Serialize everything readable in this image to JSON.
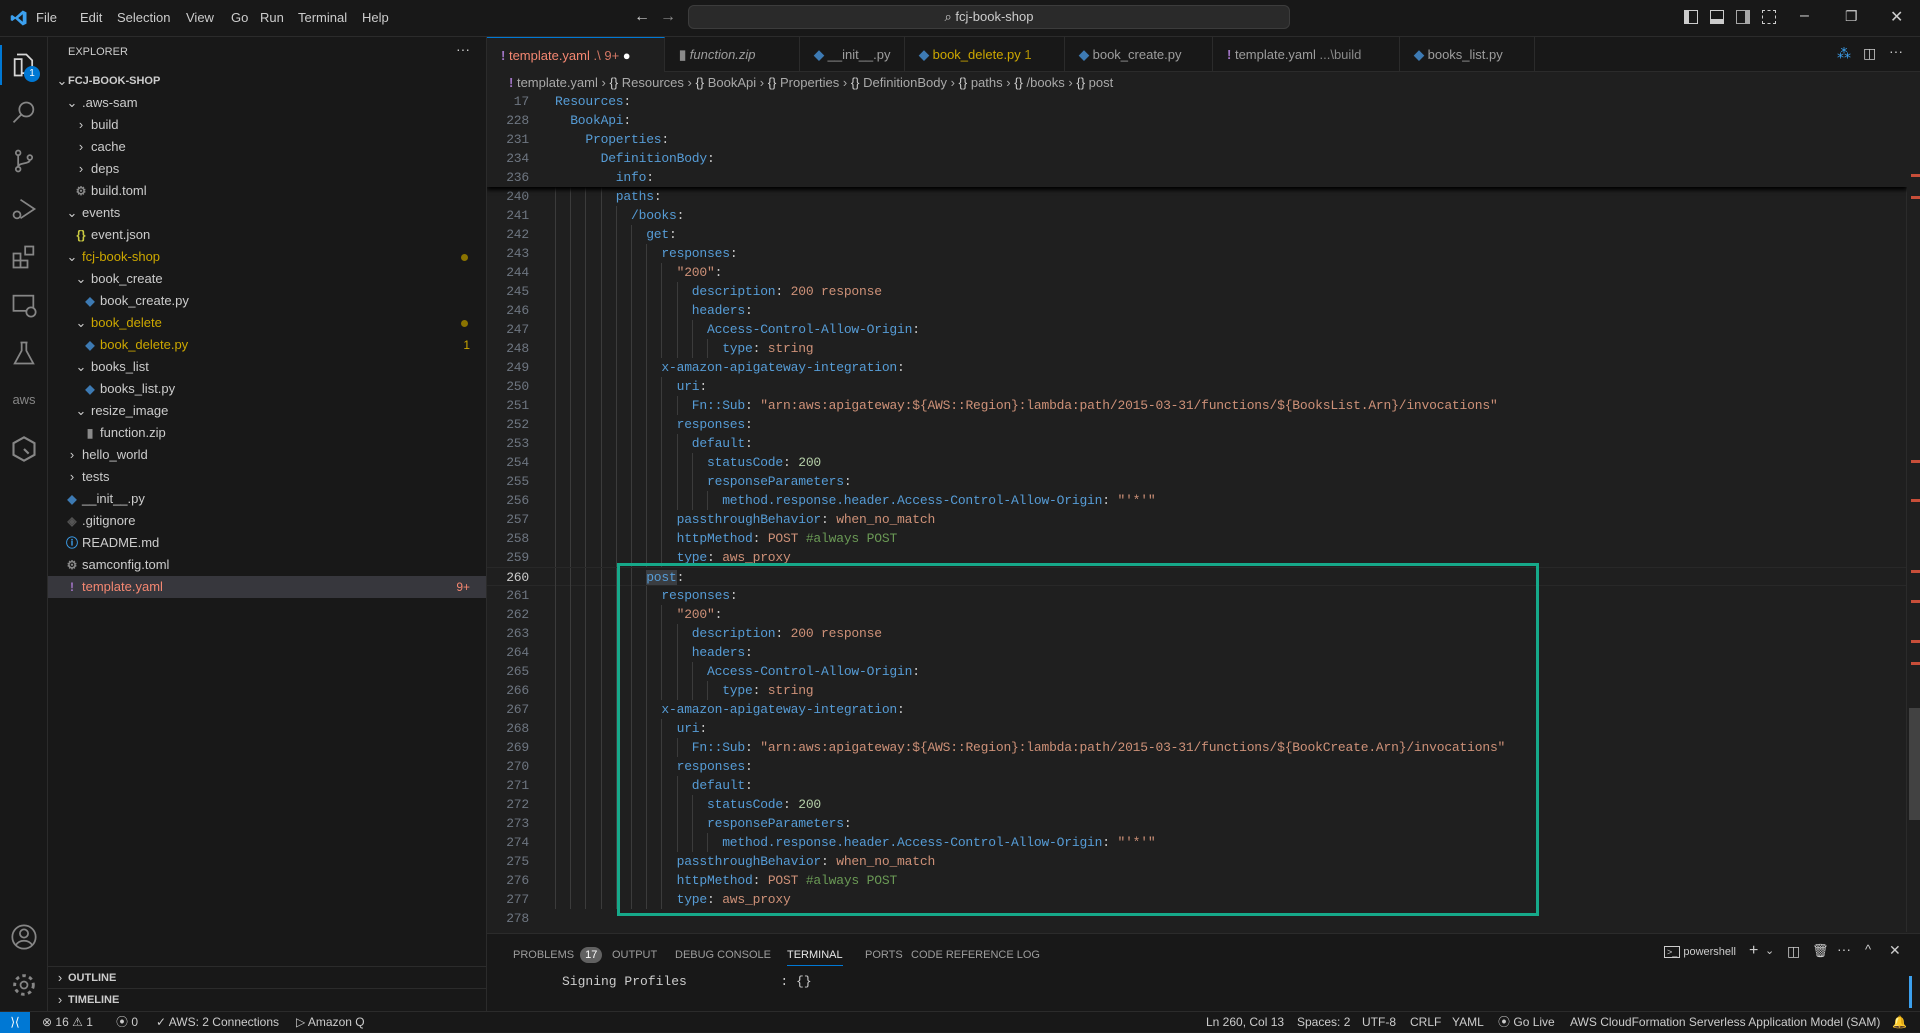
{
  "titlebar": {
    "menus": [
      "File",
      "Edit",
      "Selection",
      "View",
      "Go",
      "Run",
      "Terminal",
      "Help"
    ],
    "search": "fcj-book-shop"
  },
  "colors": {
    "accent": "#0078d4",
    "highlight_box": "#16a98a",
    "git_modified": "#cca700",
    "error": "#f48771"
  },
  "sidebar": {
    "title": "EXPLORER",
    "root": "FCJ-BOOK-SHOP",
    "outline": "OUTLINE",
    "timeline": "TIMELINE",
    "explorer_badge": "1",
    "items": [
      {
        "label": ".aws-sam",
        "level": 0,
        "kind": "folder-open"
      },
      {
        "label": "build",
        "level": 1,
        "kind": "folder-closed"
      },
      {
        "label": "cache",
        "level": 1,
        "kind": "folder-closed"
      },
      {
        "label": "deps",
        "level": 1,
        "kind": "folder-closed"
      },
      {
        "label": "build.toml",
        "level": 1,
        "kind": "file",
        "icon": "gear"
      },
      {
        "label": "events",
        "level": 0,
        "kind": "folder-open"
      },
      {
        "label": "event.json",
        "level": 1,
        "kind": "file",
        "icon": "json"
      },
      {
        "label": "fcj-book-shop",
        "level": 0,
        "kind": "folder-open",
        "status": "modified",
        "dot": true
      },
      {
        "label": "book_create",
        "level": 1,
        "kind": "folder-open"
      },
      {
        "label": "book_create.py",
        "level": 2,
        "kind": "file",
        "icon": "python"
      },
      {
        "label": "book_delete",
        "level": 1,
        "kind": "folder-open",
        "status": "modified",
        "dot": true
      },
      {
        "label": "book_delete.py",
        "level": 2,
        "kind": "file",
        "icon": "python",
        "status": "modified",
        "badge": "1"
      },
      {
        "label": "books_list",
        "level": 1,
        "kind": "folder-open"
      },
      {
        "label": "books_list.py",
        "level": 2,
        "kind": "file",
        "icon": "python"
      },
      {
        "label": "resize_image",
        "level": 1,
        "kind": "folder-open"
      },
      {
        "label": "function.zip",
        "level": 2,
        "kind": "file",
        "icon": "zip"
      },
      {
        "label": "hello_world",
        "level": 0,
        "kind": "folder-closed"
      },
      {
        "label": "tests",
        "level": 0,
        "kind": "folder-closed"
      },
      {
        "label": "__init__.py",
        "level": 0,
        "kind": "file",
        "icon": "python"
      },
      {
        "label": ".gitignore",
        "level": 0,
        "kind": "file",
        "icon": "git"
      },
      {
        "label": "README.md",
        "level": 0,
        "kind": "file",
        "icon": "info"
      },
      {
        "label": "samconfig.toml",
        "level": 0,
        "kind": "file",
        "icon": "gear"
      },
      {
        "label": "template.yaml",
        "level": 0,
        "kind": "file",
        "icon": "yaml",
        "status": "error",
        "badge": "9+",
        "selected": true
      }
    ]
  },
  "tabs": [
    {
      "label": "template.yaml",
      "desc": ".\\ 9+",
      "icon": "yaml",
      "active": true,
      "dirty": true
    },
    {
      "label": "function.zip",
      "icon": "zip",
      "italic": true
    },
    {
      "label": "__init__.py",
      "icon": "python"
    },
    {
      "label": "book_delete.py",
      "desc": "1",
      "icon": "python",
      "status": "modified"
    },
    {
      "label": "book_create.py",
      "icon": "python"
    },
    {
      "label": "template.yaml",
      "desc": "...\\build",
      "icon": "yaml"
    },
    {
      "label": "books_list.py",
      "icon": "python"
    }
  ],
  "breadcrumb": [
    "template.yaml",
    "Resources",
    "BookApi",
    "Properties",
    "DefinitionBody",
    "paths",
    "/books",
    "post"
  ],
  "editor": {
    "current_line": 260,
    "sticky": [
      {
        "n": 17,
        "i": 0,
        "t": [
          [
            "k",
            "Resources"
          ],
          [
            "p",
            ":"
          ]
        ]
      },
      {
        "n": 228,
        "i": 2,
        "t": [
          [
            "k",
            "BookApi"
          ],
          [
            "p",
            ":"
          ]
        ]
      },
      {
        "n": 231,
        "i": 4,
        "t": [
          [
            "k",
            "Properties"
          ],
          [
            "p",
            ":"
          ]
        ]
      },
      {
        "n": 234,
        "i": 6,
        "t": [
          [
            "k",
            "DefinitionBody"
          ],
          [
            "p",
            ":"
          ]
        ]
      },
      {
        "n": 236,
        "i": 8,
        "t": [
          [
            "k",
            "info"
          ],
          [
            "p",
            ":"
          ]
        ]
      }
    ],
    "lines": [
      {
        "n": 240,
        "i": 8,
        "t": [
          [
            "k",
            "paths"
          ],
          [
            "p",
            ":"
          ]
        ]
      },
      {
        "n": 241,
        "i": 10,
        "t": [
          [
            "k",
            "/books"
          ],
          [
            "p",
            ":"
          ]
        ]
      },
      {
        "n": 242,
        "i": 12,
        "t": [
          [
            "k",
            "get"
          ],
          [
            "p",
            ":"
          ]
        ]
      },
      {
        "n": 243,
        "i": 14,
        "t": [
          [
            "k",
            "responses"
          ],
          [
            "p",
            ":"
          ]
        ]
      },
      {
        "n": 244,
        "i": 16,
        "t": [
          [
            "s",
            "\"200\""
          ],
          [
            "p",
            ":"
          ]
        ]
      },
      {
        "n": 245,
        "i": 18,
        "t": [
          [
            "k",
            "description"
          ],
          [
            "p",
            ": "
          ],
          [
            "s",
            "200 response"
          ]
        ]
      },
      {
        "n": 246,
        "i": 18,
        "t": [
          [
            "k",
            "headers"
          ],
          [
            "p",
            ":"
          ]
        ]
      },
      {
        "n": 247,
        "i": 20,
        "t": [
          [
            "k",
            "Access-Control-Allow-Origin"
          ],
          [
            "p",
            ":"
          ]
        ]
      },
      {
        "n": 248,
        "i": 22,
        "t": [
          [
            "k",
            "type"
          ],
          [
            "p",
            ": "
          ],
          [
            "s",
            "string"
          ]
        ]
      },
      {
        "n": 249,
        "i": 14,
        "t": [
          [
            "k",
            "x-amazon-apigateway-integration"
          ],
          [
            "p",
            ":"
          ]
        ]
      },
      {
        "n": 250,
        "i": 16,
        "t": [
          [
            "k",
            "uri"
          ],
          [
            "p",
            ":"
          ]
        ]
      },
      {
        "n": 251,
        "i": 18,
        "t": [
          [
            "k",
            "Fn::Sub"
          ],
          [
            "p",
            ": "
          ],
          [
            "s",
            "\"arn:aws:apigateway:${AWS::Region}:lambda:path/2015-03-31/functions/${BooksList.Arn}/invocations\""
          ]
        ]
      },
      {
        "n": 252,
        "i": 16,
        "t": [
          [
            "k",
            "responses"
          ],
          [
            "p",
            ":"
          ]
        ]
      },
      {
        "n": 253,
        "i": 18,
        "t": [
          [
            "k",
            "default"
          ],
          [
            "p",
            ":"
          ]
        ]
      },
      {
        "n": 254,
        "i": 20,
        "t": [
          [
            "k",
            "statusCode"
          ],
          [
            "p",
            ": "
          ],
          [
            "n",
            "200"
          ]
        ]
      },
      {
        "n": 255,
        "i": 20,
        "t": [
          [
            "k",
            "responseParameters"
          ],
          [
            "p",
            ":"
          ]
        ]
      },
      {
        "n": 256,
        "i": 22,
        "t": [
          [
            "k",
            "method.response.header.Access-Control-Allow-Origin"
          ],
          [
            "p",
            ": "
          ],
          [
            "s",
            "\"'*'\""
          ]
        ]
      },
      {
        "n": 257,
        "i": 16,
        "t": [
          [
            "k",
            "passthroughBehavior"
          ],
          [
            "p",
            ": "
          ],
          [
            "s",
            "when_no_match"
          ]
        ]
      },
      {
        "n": 258,
        "i": 16,
        "t": [
          [
            "k",
            "httpMethod"
          ],
          [
            "p",
            ": "
          ],
          [
            "s",
            "POST "
          ],
          [
            "c",
            "#always POST"
          ]
        ]
      },
      {
        "n": 259,
        "i": 16,
        "t": [
          [
            "k",
            "type"
          ],
          [
            "p",
            ": "
          ],
          [
            "s",
            "aws_proxy"
          ]
        ]
      },
      {
        "n": 260,
        "i": 12,
        "t": [
          [
            "k",
            "post"
          ],
          [
            "p",
            ":"
          ]
        ],
        "selected_word": "post"
      },
      {
        "n": 261,
        "i": 14,
        "t": [
          [
            "k",
            "responses"
          ],
          [
            "p",
            ":"
          ]
        ]
      },
      {
        "n": 262,
        "i": 16,
        "t": [
          [
            "s",
            "\"200\""
          ],
          [
            "p",
            ":"
          ]
        ]
      },
      {
        "n": 263,
        "i": 18,
        "t": [
          [
            "k",
            "description"
          ],
          [
            "p",
            ": "
          ],
          [
            "s",
            "200 response"
          ]
        ]
      },
      {
        "n": 264,
        "i": 18,
        "t": [
          [
            "k",
            "headers"
          ],
          [
            "p",
            ":"
          ]
        ]
      },
      {
        "n": 265,
        "i": 20,
        "t": [
          [
            "k",
            "Access-Control-Allow-Origin"
          ],
          [
            "p",
            ":"
          ]
        ]
      },
      {
        "n": 266,
        "i": 22,
        "t": [
          [
            "k",
            "type"
          ],
          [
            "p",
            ": "
          ],
          [
            "s",
            "string"
          ]
        ]
      },
      {
        "n": 267,
        "i": 14,
        "t": [
          [
            "k",
            "x-amazon-apigateway-integration"
          ],
          [
            "p",
            ":"
          ]
        ]
      },
      {
        "n": 268,
        "i": 16,
        "t": [
          [
            "k",
            "uri"
          ],
          [
            "p",
            ":"
          ]
        ]
      },
      {
        "n": 269,
        "i": 18,
        "t": [
          [
            "k",
            "Fn::Sub"
          ],
          [
            "p",
            ": "
          ],
          [
            "s",
            "\"arn:aws:apigateway:${AWS::Region}:lambda:path/2015-03-31/functions/${BookCreate.Arn}/invocations\""
          ]
        ]
      },
      {
        "n": 270,
        "i": 16,
        "t": [
          [
            "k",
            "responses"
          ],
          [
            "p",
            ":"
          ]
        ]
      },
      {
        "n": 271,
        "i": 18,
        "t": [
          [
            "k",
            "default"
          ],
          [
            "p",
            ":"
          ]
        ]
      },
      {
        "n": 272,
        "i": 20,
        "t": [
          [
            "k",
            "statusCode"
          ],
          [
            "p",
            ": "
          ],
          [
            "n",
            "200"
          ]
        ]
      },
      {
        "n": 273,
        "i": 20,
        "t": [
          [
            "k",
            "responseParameters"
          ],
          [
            "p",
            ":"
          ]
        ]
      },
      {
        "n": 274,
        "i": 22,
        "t": [
          [
            "k",
            "method.response.header.Access-Control-Allow-Origin"
          ],
          [
            "p",
            ": "
          ],
          [
            "s",
            "\"'*'\""
          ]
        ]
      },
      {
        "n": 275,
        "i": 16,
        "t": [
          [
            "k",
            "passthroughBehavior"
          ],
          [
            "p",
            ": "
          ],
          [
            "s",
            "when_no_match"
          ]
        ]
      },
      {
        "n": 276,
        "i": 16,
        "t": [
          [
            "k",
            "httpMethod"
          ],
          [
            "p",
            ": "
          ],
          [
            "s",
            "POST "
          ],
          [
            "c",
            "#always POST"
          ]
        ]
      },
      {
        "n": 277,
        "i": 16,
        "t": [
          [
            "k",
            "type"
          ],
          [
            "p",
            ": "
          ],
          [
            "s",
            "aws_proxy"
          ]
        ]
      },
      {
        "n": 278,
        "i": 0,
        "t": []
      }
    ]
  },
  "panel": {
    "tabs": [
      "PROBLEMS",
      "OUTPUT",
      "DEBUG CONSOLE",
      "TERMINAL",
      "PORTS",
      "CODE REFERENCE LOG"
    ],
    "active_tab": "TERMINAL",
    "problems_count": "17",
    "shell": "powershell",
    "terminal_text": "Signing Profiles            : {}"
  },
  "statusbar": {
    "errors": "16",
    "warnings": "1",
    "ports": "0",
    "aws": "AWS: 2 Connections",
    "amazonq": "Amazon Q",
    "position": "Ln 260, Col 13",
    "spaces": "Spaces: 2",
    "encoding": "UTF-8",
    "eol": "CRLF",
    "language": "YAML",
    "golive": "Go Live",
    "sam": "AWS CloudFormation Serverless Application Model (SAM)"
  }
}
